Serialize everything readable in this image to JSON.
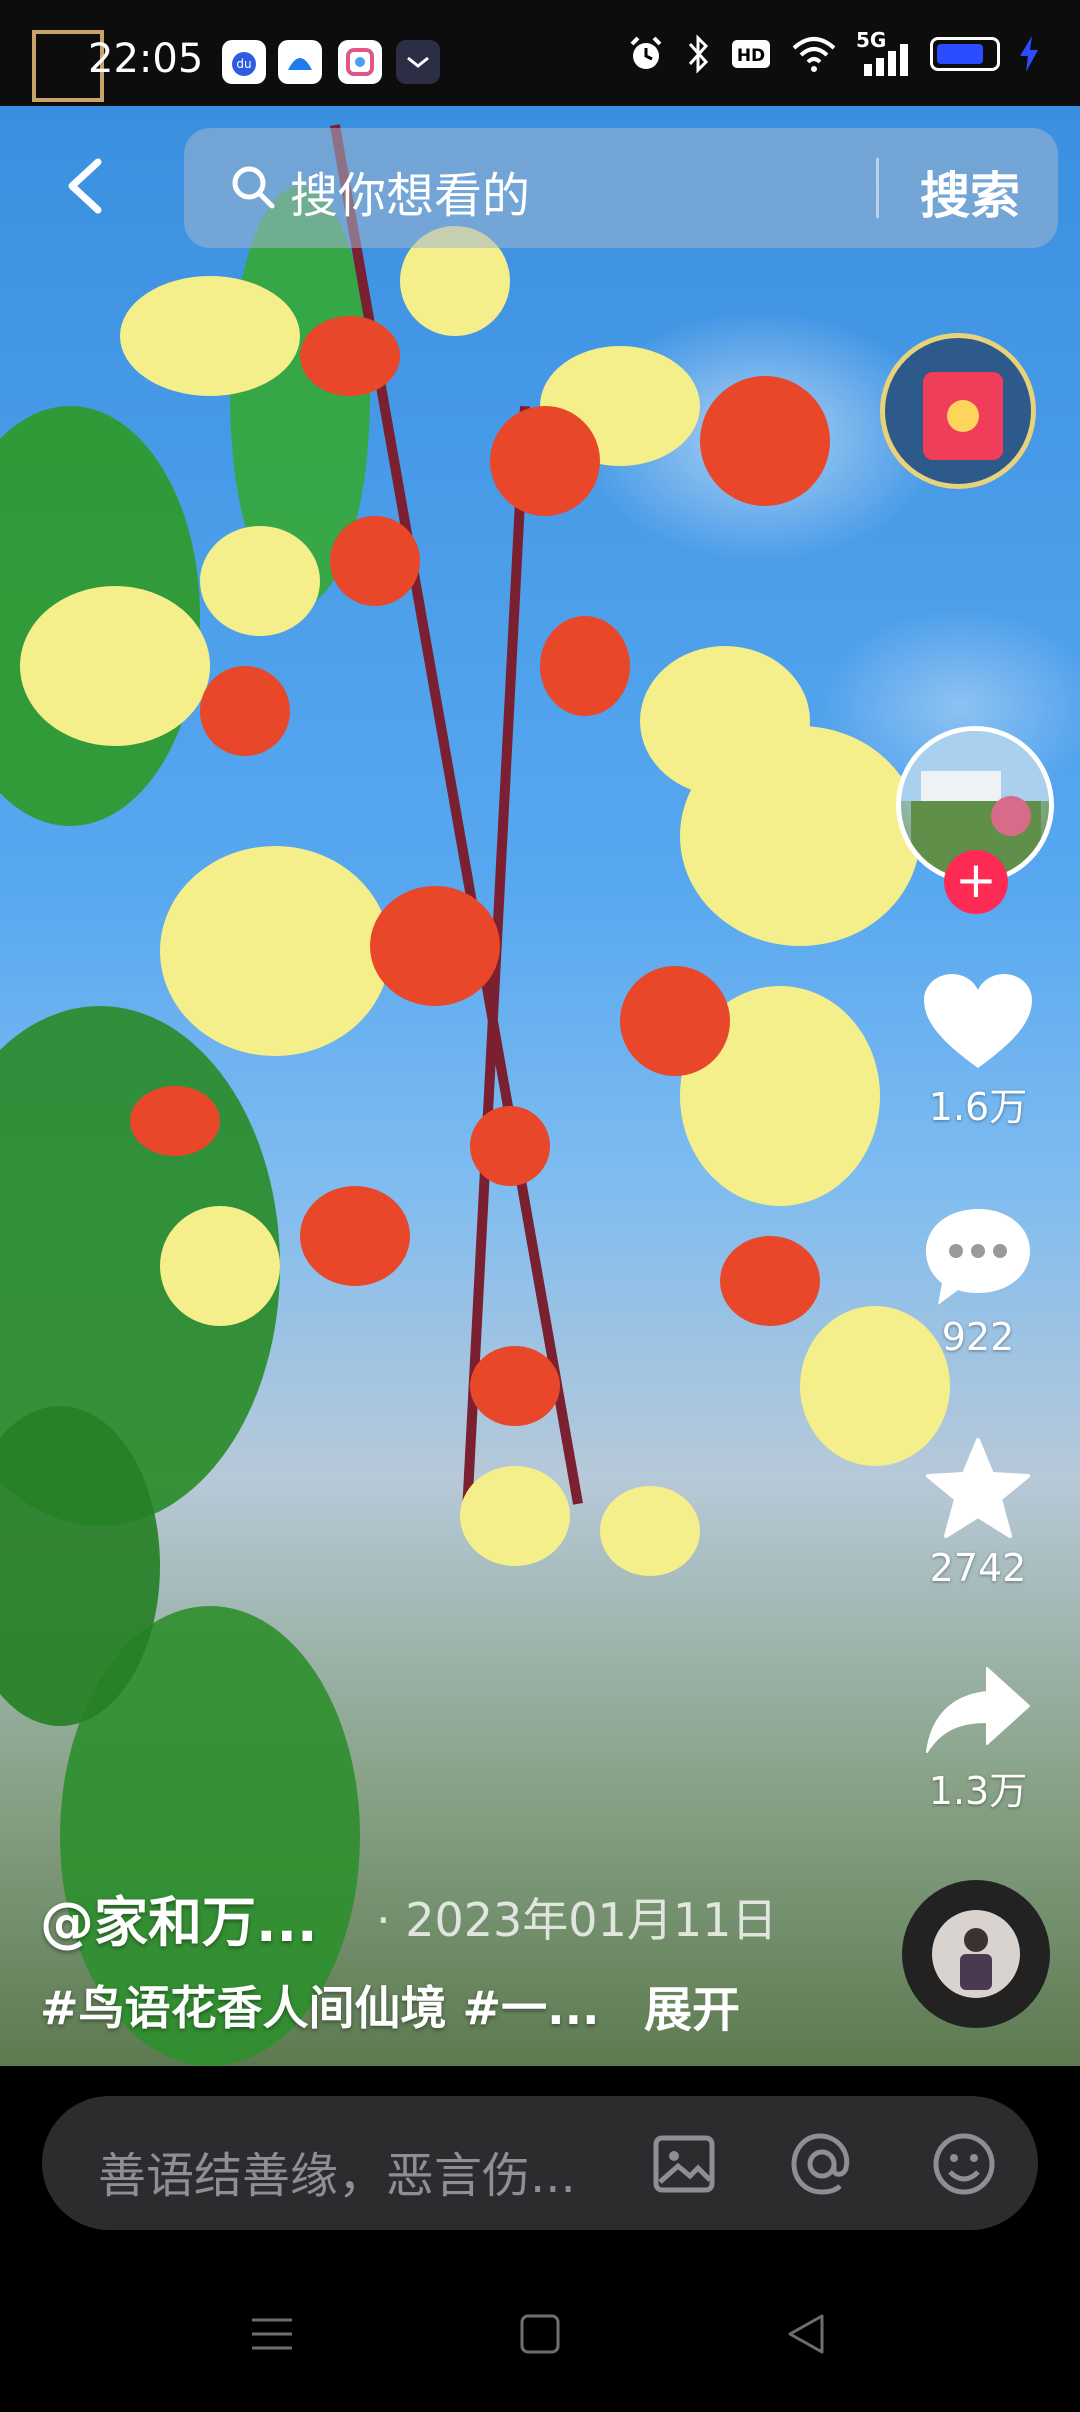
{
  "status_bar": {
    "time": "22:05",
    "network": "5G",
    "icons": [
      "baidu-app-icon",
      "app-icon",
      "photo-app-icon",
      "message-app-icon",
      "alarm-icon",
      "bluetooth-icon",
      "hd-icon",
      "wifi-icon",
      "signal-icon",
      "battery-icon",
      "charging-icon"
    ],
    "battery_level": 0.8
  },
  "search": {
    "placeholder": "搜你想看的",
    "button_label": "搜索"
  },
  "actions": {
    "likes": "1.6万",
    "comments": "922",
    "favorites": "2742",
    "shares": "1.3万"
  },
  "video": {
    "author": "@家和万...",
    "date": "· 2023年01月11日",
    "tags": "#鸟语花香人间仙境 #一...",
    "expand_label": "展开"
  },
  "comment": {
    "placeholder": "善语结善缘，恶言伤..."
  },
  "colors": {
    "accent": "#fe2c55",
    "background": "#000000",
    "comment_bar": "#2c2c2e"
  }
}
